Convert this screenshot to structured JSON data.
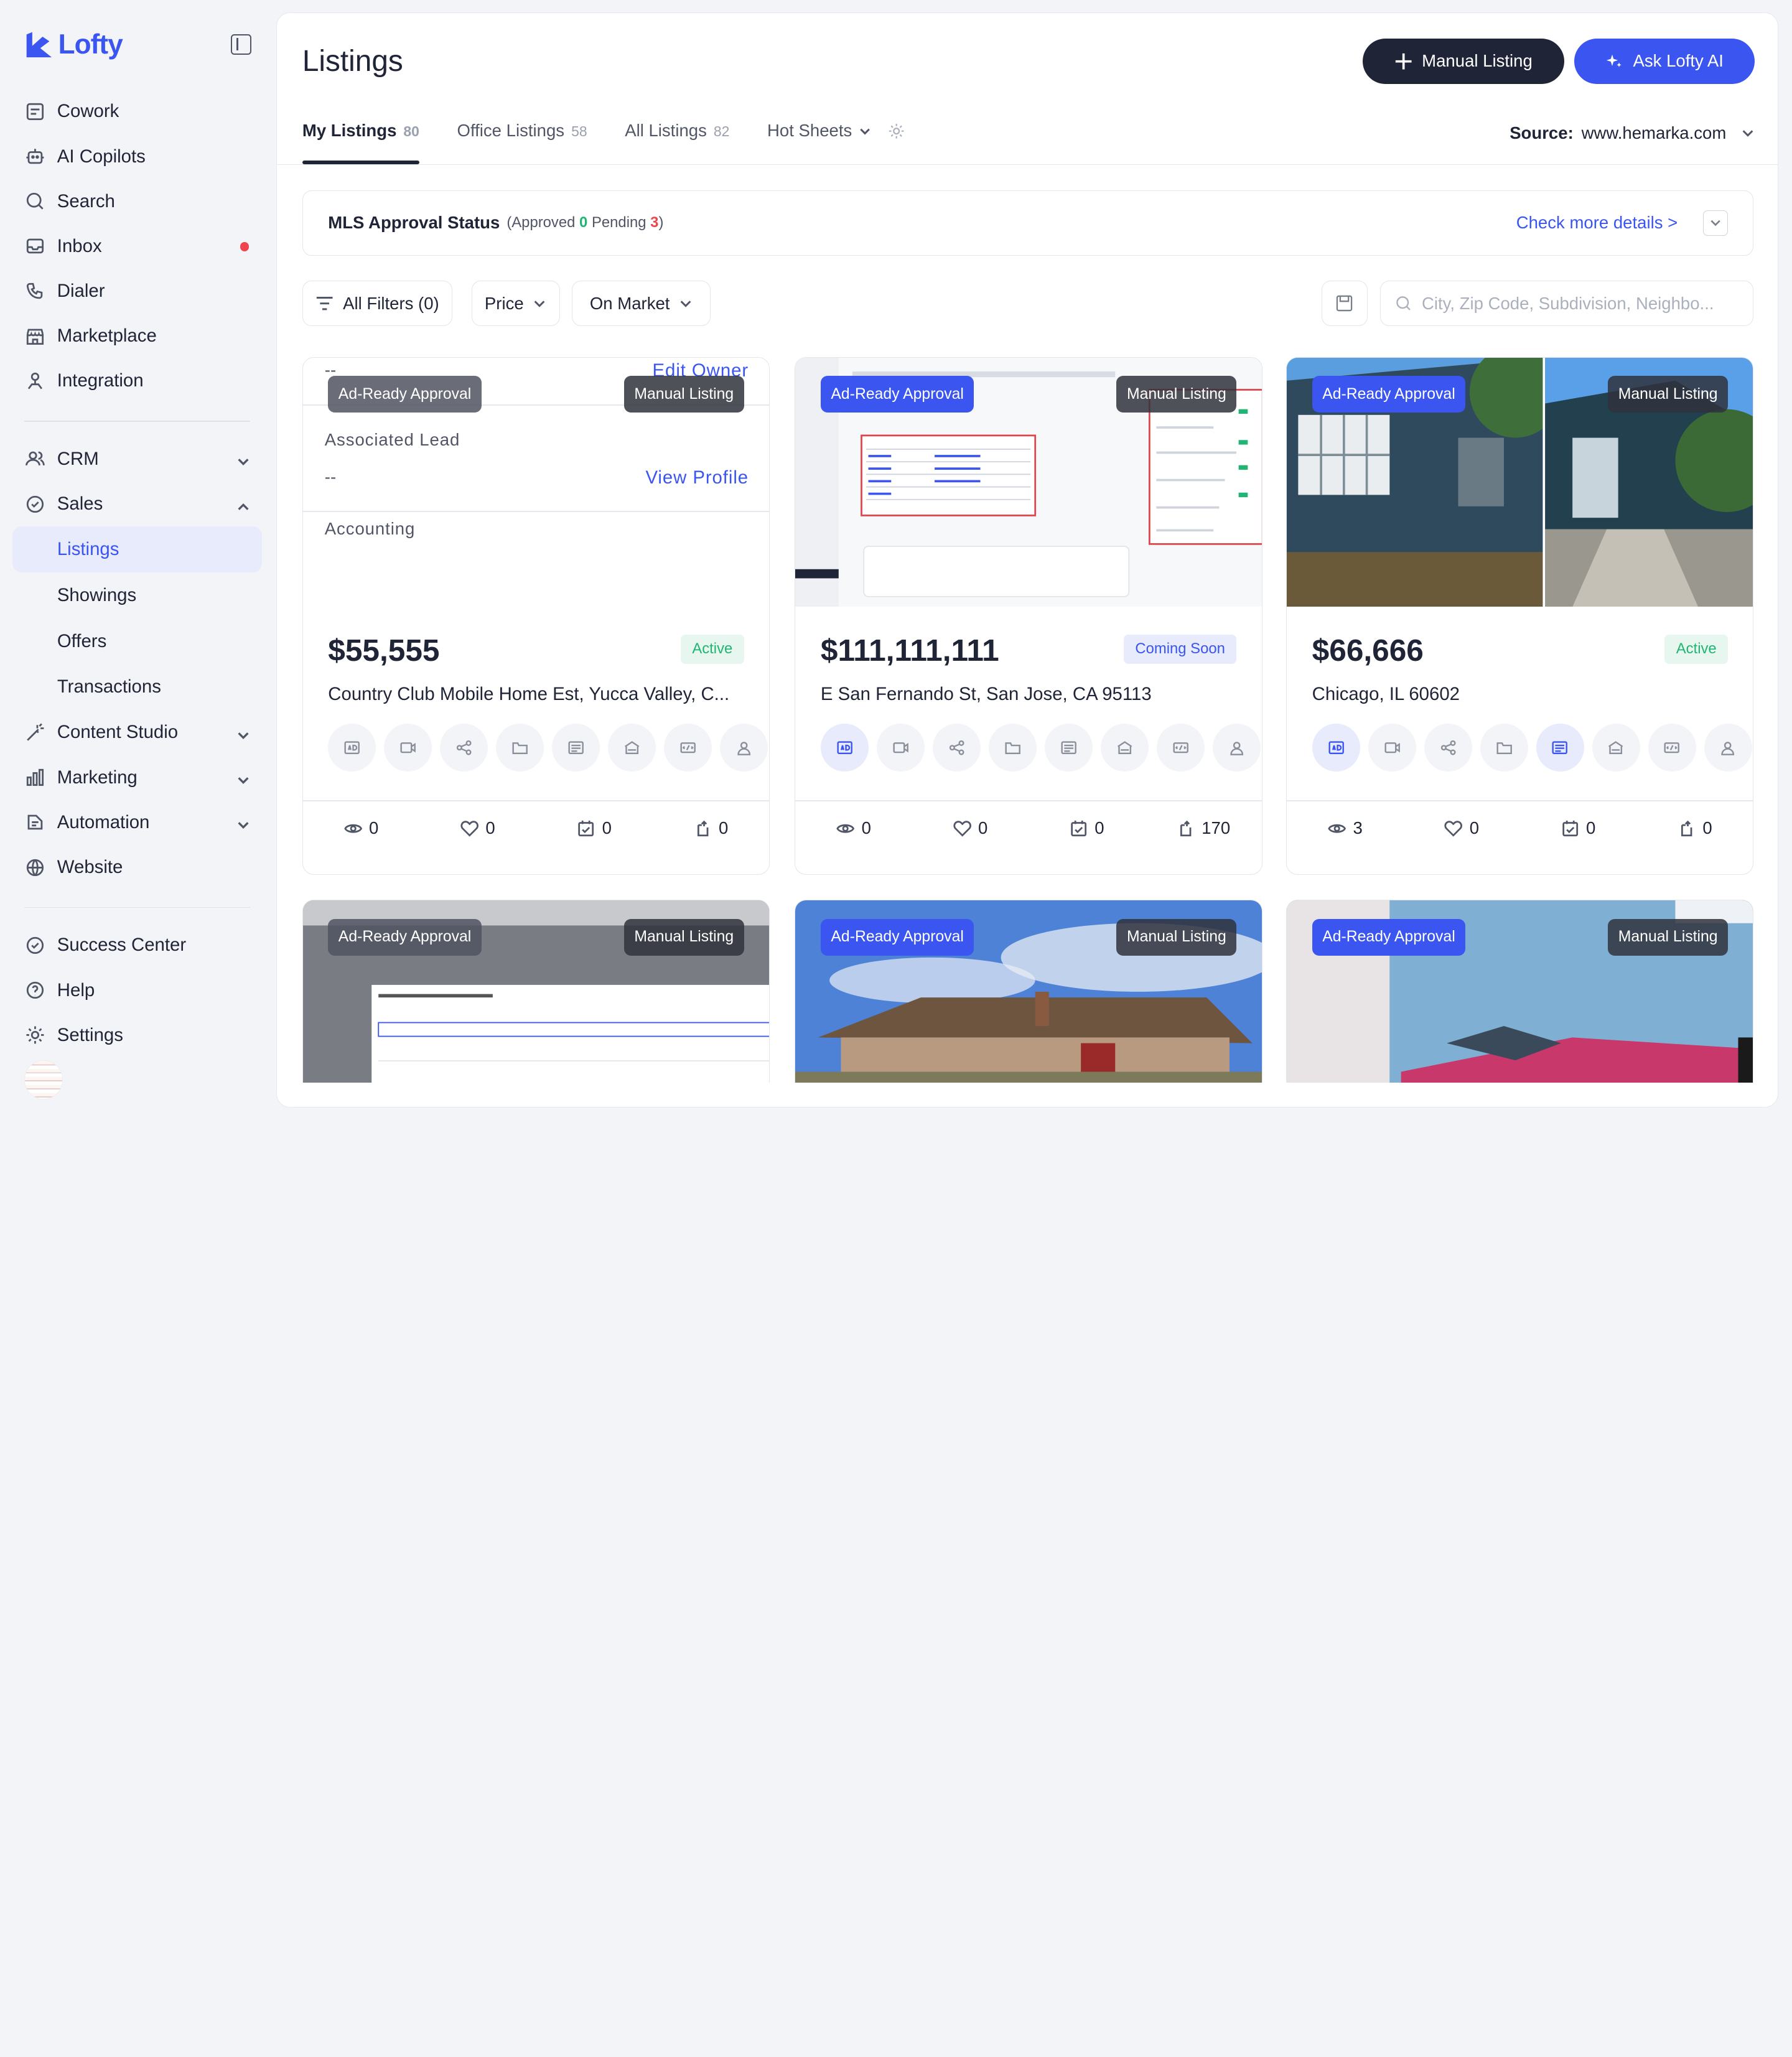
{
  "app": {
    "name": "Lofty"
  },
  "sidebar": {
    "top_items": [
      {
        "label": "Cowork"
      },
      {
        "label": "AI Copilots"
      },
      {
        "label": "Search"
      },
      {
        "label": "Inbox"
      },
      {
        "label": "Dialer"
      },
      {
        "label": "Marketplace"
      },
      {
        "label": "Integration"
      }
    ],
    "crm": "CRM",
    "sales": "Sales",
    "sales_sub": [
      "Listings",
      "Showings",
      "Offers",
      "Transactions"
    ],
    "content_studio": "Content Studio",
    "marketing": "Marketing",
    "automation": "Automation",
    "website": "Website",
    "success_center": "Success Center",
    "help": "Help",
    "settings": "Settings"
  },
  "header": {
    "title": "Listings",
    "manual_listing_btn": "Manual Listing",
    "ask_ai_btn": "Ask Lofty AI"
  },
  "tabs": [
    {
      "label": "My Listings",
      "count": "80"
    },
    {
      "label": "Office Listings",
      "count": "58"
    },
    {
      "label": "All Listings",
      "count": "82"
    },
    {
      "label": "Hot Sheets"
    }
  ],
  "source": {
    "label": "Source:",
    "value": "www.hemarka.com"
  },
  "mls": {
    "title": "MLS Approval Status",
    "approved_label": "(Approved",
    "approved_count": "0",
    "pending_label": "Pending",
    "pending_count": "3",
    "close": ")",
    "link": "Check more details >"
  },
  "filters": {
    "all": "All Filters (0)",
    "price": "Price",
    "market": "On Market",
    "search_placeholder": "City, Zip Code, Subdivision, Neighbo..."
  },
  "badges": {
    "ad_ready": "Ad-Ready Approval",
    "manual": "Manual Listing"
  },
  "card1_info": {
    "dash1": "--",
    "edit_owner": "Edit Owner",
    "associated_lead": "Associated Lead",
    "dash2": "--",
    "view_profile": "View Profile",
    "accounting": "Accounting"
  },
  "listings": [
    {
      "price": "$55,555",
      "status": "Active",
      "address": "Country Club Mobile Home Est, Yucca Valley, C...",
      "views": "0",
      "likes": "0",
      "showings": "0",
      "shares": "0"
    },
    {
      "price": "$111,111,111",
      "status": "Coming Soon",
      "address": "E San Fernando St, San Jose, CA 95113",
      "views": "0",
      "likes": "0",
      "showings": "0",
      "shares": "170"
    },
    {
      "price": "$66,666",
      "status": "Active",
      "address": "Chicago, IL 60602",
      "views": "3",
      "likes": "0",
      "showings": "0",
      "shares": "0"
    }
  ],
  "action_icons": [
    "ad-icon",
    "video-icon",
    "share-icon",
    "folder-icon",
    "flyer-icon",
    "open-house-icon",
    "code-icon",
    "owner-icon"
  ],
  "colors": {
    "accent": "#3a55f0",
    "dark": "#202437",
    "active_green": "#21b573",
    "alert_red": "#f0454c"
  }
}
